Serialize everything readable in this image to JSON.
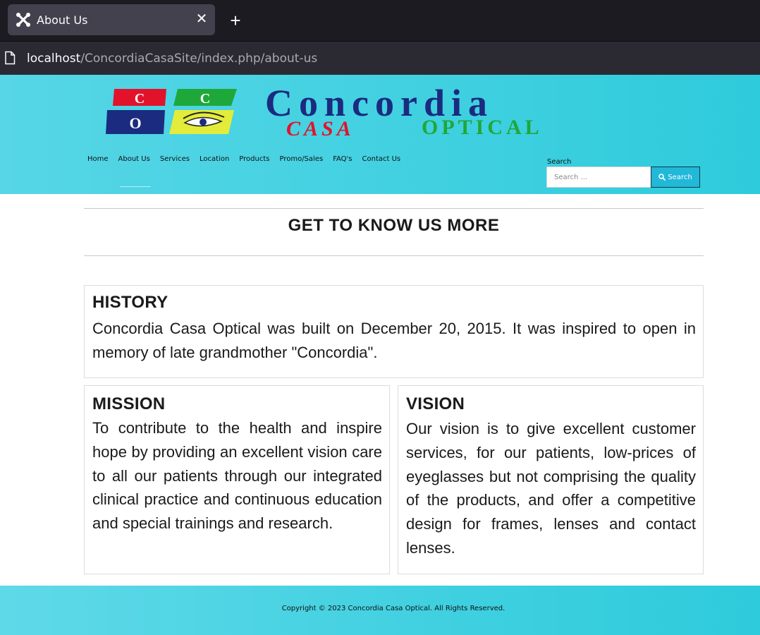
{
  "browser": {
    "tab_title": "About Us",
    "close_glyph": "✕",
    "new_tab_glyph": "+",
    "url_host": "localhost",
    "url_path": "/ConcordiaCasaSite/index.php/about-us"
  },
  "logo": {
    "blocks": [
      "C",
      "C",
      "O"
    ],
    "name": "Concordia",
    "casa": "CASA",
    "optical": "OPTICAL",
    "colors": {
      "navy": "#1a2b80",
      "red": "#e3122b",
      "green": "#1fa83a",
      "yellow": "#e3ec3a"
    }
  },
  "nav": {
    "items": [
      "Home",
      "About Us",
      "Services",
      "Location",
      "Products",
      "Promo/Sales",
      "FAQ's",
      "Contact Us"
    ]
  },
  "search": {
    "label": "Search",
    "placeholder": "Search ...",
    "button_label": "Search"
  },
  "main": {
    "title": "GET TO KNOW US MORE",
    "history": {
      "heading": "HISTORY",
      "body": "Concordia Casa Optical was built on December 20, 2015. It was inspired to open in memory of late grandmother \"Concordia\"."
    },
    "mission": {
      "heading": "MISSION",
      "body": "To contribute to the health and inspire hope by providing an excellent vision care to all our patients through our integrated clinical practice and continuous education and special trainings and research."
    },
    "vision": {
      "heading": "VISION",
      "body": "Our vision is to give excellent customer services, for our patients, low-prices of eyeglasses but not comprising the quality of the products, and offer a competitive design for frames, lenses and contact lenses."
    }
  },
  "footer": {
    "copyright": "Copyright © 2023 Concordia Casa Optical. All Rights Reserved."
  },
  "colors": {
    "header_bg": "#3fd0e0",
    "search_button": "#22b8d8",
    "browser_dark": "#1c1b22"
  }
}
